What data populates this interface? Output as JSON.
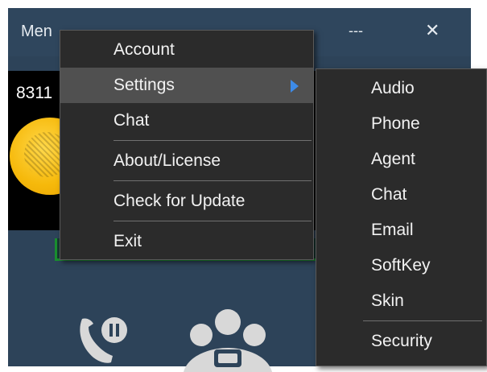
{
  "window": {
    "title_menu": "Men",
    "more_label": "---",
    "close_label": "✕"
  },
  "panel": {
    "number_partial": "8311"
  },
  "main_menu": {
    "items": [
      {
        "label": "Account"
      },
      {
        "label": "Settings"
      },
      {
        "label": "Chat"
      },
      {
        "label": "About/License"
      },
      {
        "label": "Check for Update"
      },
      {
        "label": "Exit"
      }
    ],
    "highlight_color": "#505050",
    "arrow_color": "#3d8be8"
  },
  "settings_submenu": {
    "items": [
      {
        "label": "Audio"
      },
      {
        "label": "Phone"
      },
      {
        "label": "Agent"
      },
      {
        "label": "Chat"
      },
      {
        "label": "Email"
      },
      {
        "label": "SoftKey"
      },
      {
        "label": "Skin"
      },
      {
        "label": "Security"
      }
    ]
  },
  "icons": {
    "avatar": "user-avatar",
    "hold_call": "phone-hold-icon",
    "conference": "conference-icon"
  }
}
